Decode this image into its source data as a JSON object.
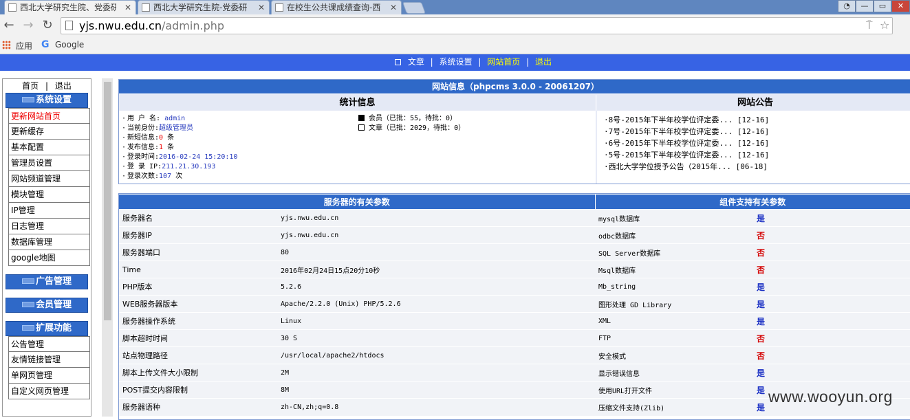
{
  "browser": {
    "tabs": [
      {
        "title": "西北大学研究生院、党委研"
      },
      {
        "title": "西北大学研究生院-党委研"
      },
      {
        "title": "在校生公共课成绩查询-西"
      }
    ],
    "url_host": "yjs.nwu.edu.cn",
    "url_path": "/admin.php",
    "bookmarks": [
      {
        "label": "应用"
      },
      {
        "label": "Google"
      }
    ]
  },
  "topnav": {
    "items": [
      {
        "label": "文章"
      },
      {
        "label": "系统设置"
      },
      {
        "label": "网站首页"
      },
      {
        "label": "退出"
      }
    ],
    "separator": "|"
  },
  "sidebar": {
    "top_links": {
      "home": "首页",
      "sep": "|",
      "logout": "退出"
    },
    "sections": [
      {
        "title": "系统设置",
        "items": [
          {
            "label": "更新网站首页",
            "active": true
          },
          {
            "label": "更新缓存"
          },
          {
            "label": "基本配置"
          },
          {
            "label": "管理员设置"
          },
          {
            "label": "网站频道管理"
          },
          {
            "label": "模块管理"
          },
          {
            "label": "IP管理"
          },
          {
            "label": "日志管理"
          },
          {
            "label": "数据库管理"
          },
          {
            "label": "google地图"
          }
        ]
      },
      {
        "title": "广告管理",
        "items": []
      },
      {
        "title": "会员管理",
        "items": []
      },
      {
        "title": "扩展功能",
        "items": [
          {
            "label": "公告管理"
          },
          {
            "label": "友情链接管理"
          },
          {
            "label": "单网页管理"
          },
          {
            "label": "自定义网页管理"
          }
        ]
      }
    ]
  },
  "site_info": {
    "title": "网站信息（phpcms 3.0.0 - 20061207）",
    "stats_header": "统计信息",
    "announce_header": "网站公告",
    "stats": {
      "username_label": "用 户 名:",
      "username": "admin",
      "role_label": "当前身份:",
      "role": "超级管理员",
      "sms_label": "新短信息:",
      "sms_count": "0",
      "sms_unit": "条",
      "posts_label": "发布信息:",
      "posts_count": "1",
      "posts_unit": "条",
      "login_time_label": "登录时间:",
      "login_time": "2016-02-24 15:20:10",
      "login_ip_label": "登 录 IP:",
      "login_ip": "211.21.30.193",
      "login_count_label": "登录次数:",
      "login_count": "107",
      "login_count_unit": "次",
      "members": "会员（已批：55，待批：0）",
      "articles": "文章（已批：2029，待批：0）"
    },
    "announcements": [
      {
        "text": "8号-2015年下半年校学位评定委...",
        "date": "[12-16]"
      },
      {
        "text": "7号-2015年下半年校学位评定委...",
        "date": "[12-16]"
      },
      {
        "text": "6号-2015年下半年校学位评定委...",
        "date": "[12-16]"
      },
      {
        "text": "5号-2015年下半年校学位评定委...",
        "date": "[12-16]"
      },
      {
        "text": "西北大学学位授予公告（2015年...",
        "date": "[06-18]"
      }
    ]
  },
  "server_table": {
    "left_header": "服务器的有关参数",
    "right_header": "组件支持有关参数",
    "rows": [
      {
        "name": "服务器名",
        "value": "yjs.nwu.edu.cn",
        "comp": "mysql数据库",
        "support": "是"
      },
      {
        "name": "服务器IP",
        "value": "yjs.nwu.edu.cn",
        "comp": "odbc数据库",
        "support": "否"
      },
      {
        "name": "服务器端口",
        "value": "80",
        "comp": "SQL Server数据库",
        "support": "否"
      },
      {
        "name": "Time",
        "value": "2016年02月24日15点20分10秒",
        "comp": "Msql数据库",
        "support": "否"
      },
      {
        "name": "PHP版本",
        "value": "5.2.6",
        "comp": "Mb_string",
        "support": "是"
      },
      {
        "name": "WEB服务器版本",
        "value": "Apache/2.2.0 (Unix) PHP/5.2.6",
        "comp": "图形处理 GD Library",
        "support": "是"
      },
      {
        "name": "服务器操作系统",
        "value": "Linux",
        "comp": "XML",
        "support": "是"
      },
      {
        "name": "脚本超时时间",
        "value": "30 S",
        "comp": "FTP",
        "support": "否"
      },
      {
        "name": "站点物理路径",
        "value": "/usr/local/apache2/htdocs",
        "comp": "安全模式",
        "support": "否"
      },
      {
        "name": "脚本上传文件大小限制",
        "value": "2M",
        "comp": "显示错误信息",
        "support": "是"
      },
      {
        "name": "POST提交内容限制",
        "value": "8M",
        "comp": "使用URL打开文件",
        "support": "是"
      },
      {
        "name": "服务器语种",
        "value": "zh-CN,zh;q=0.8",
        "comp": "压缩文件支持(Zlib)",
        "support": "是"
      }
    ]
  },
  "watermark": "www.wooyun.org"
}
